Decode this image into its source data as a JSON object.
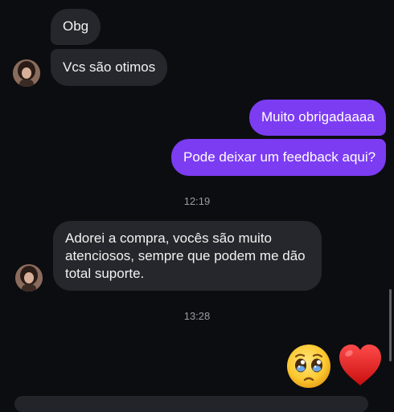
{
  "messages": {
    "m1": "Obg",
    "m2": "Vcs são otimos",
    "m3": "Muito obrigadaaaa",
    "m4": "Pode deixar um feedback aqui?",
    "m5": "Adorei a compra, vocês são muito atenciosos, sempre que podem me dão total suporte."
  },
  "timestamps": {
    "t1": "12:19",
    "t2": "13:28"
  },
  "reactions": {
    "r1_icon": "pleading-face-emoji",
    "r2_icon": "red-heart-emoji"
  },
  "colors": {
    "incoming_bubble": "#26272c",
    "outgoing_bubble": "#7c3cf2",
    "background": "#0c0d11",
    "timestamp": "#9a9ca3"
  }
}
